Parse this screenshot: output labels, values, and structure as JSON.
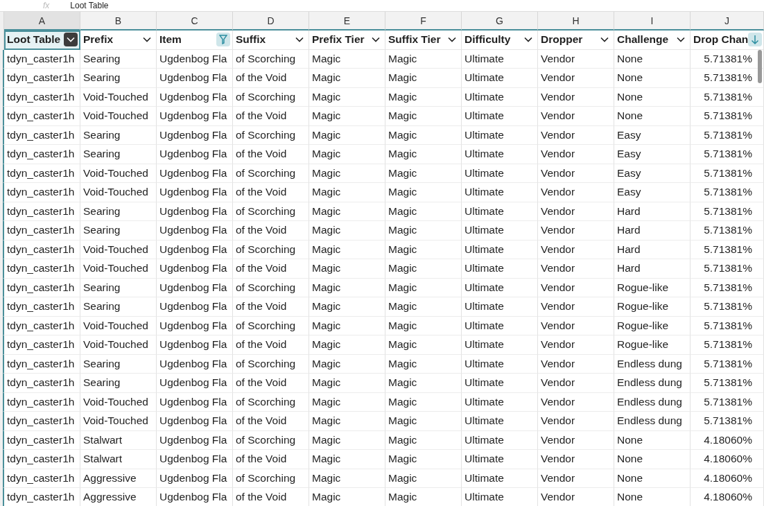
{
  "formula_bar": {
    "icon": "fx",
    "value": "Loot Table"
  },
  "column_letters": [
    "A",
    "B",
    "C",
    "D",
    "E",
    "F",
    "G",
    "H",
    "I",
    "J"
  ],
  "headers": [
    {
      "label": "Loot Table",
      "kind": "dropdown",
      "selected": true
    },
    {
      "label": "Prefix",
      "kind": "dropdown",
      "selected": false
    },
    {
      "label": "Item",
      "kind": "filter",
      "selected": false
    },
    {
      "label": "Suffix",
      "kind": "dropdown",
      "selected": false
    },
    {
      "label": "Prefix Tier",
      "kind": "dropdown",
      "selected": false
    },
    {
      "label": "Suffix Tier",
      "kind": "dropdown",
      "selected": false
    },
    {
      "label": "Difficulty",
      "kind": "dropdown",
      "selected": false
    },
    {
      "label": "Dropper",
      "kind": "dropdown",
      "selected": false
    },
    {
      "label": "Challenge",
      "kind": "dropdown",
      "selected": false
    },
    {
      "label": "Drop Chan",
      "kind": "sort",
      "selected": false
    }
  ],
  "rows": [
    [
      "tdyn_caster1h",
      "Searing",
      "Ugdenbog Fla",
      "of Scorching",
      "Magic",
      "Magic",
      "Ultimate",
      "Vendor",
      "None",
      "5.71381%"
    ],
    [
      "tdyn_caster1h",
      "Searing",
      "Ugdenbog Fla",
      "of the Void",
      "Magic",
      "Magic",
      "Ultimate",
      "Vendor",
      "None",
      "5.71381%"
    ],
    [
      "tdyn_caster1h",
      "Void-Touched",
      "Ugdenbog Fla",
      "of Scorching",
      "Magic",
      "Magic",
      "Ultimate",
      "Vendor",
      "None",
      "5.71381%"
    ],
    [
      "tdyn_caster1h",
      "Void-Touched",
      "Ugdenbog Fla",
      "of the Void",
      "Magic",
      "Magic",
      "Ultimate",
      "Vendor",
      "None",
      "5.71381%"
    ],
    [
      "tdyn_caster1h",
      "Searing",
      "Ugdenbog Fla",
      "of Scorching",
      "Magic",
      "Magic",
      "Ultimate",
      "Vendor",
      "Easy",
      "5.71381%"
    ],
    [
      "tdyn_caster1h",
      "Searing",
      "Ugdenbog Fla",
      "of the Void",
      "Magic",
      "Magic",
      "Ultimate",
      "Vendor",
      "Easy",
      "5.71381%"
    ],
    [
      "tdyn_caster1h",
      "Void-Touched",
      "Ugdenbog Fla",
      "of Scorching",
      "Magic",
      "Magic",
      "Ultimate",
      "Vendor",
      "Easy",
      "5.71381%"
    ],
    [
      "tdyn_caster1h",
      "Void-Touched",
      "Ugdenbog Fla",
      "of the Void",
      "Magic",
      "Magic",
      "Ultimate",
      "Vendor",
      "Easy",
      "5.71381%"
    ],
    [
      "tdyn_caster1h",
      "Searing",
      "Ugdenbog Fla",
      "of Scorching",
      "Magic",
      "Magic",
      "Ultimate",
      "Vendor",
      "Hard",
      "5.71381%"
    ],
    [
      "tdyn_caster1h",
      "Searing",
      "Ugdenbog Fla",
      "of the Void",
      "Magic",
      "Magic",
      "Ultimate",
      "Vendor",
      "Hard",
      "5.71381%"
    ],
    [
      "tdyn_caster1h",
      "Void-Touched",
      "Ugdenbog Fla",
      "of Scorching",
      "Magic",
      "Magic",
      "Ultimate",
      "Vendor",
      "Hard",
      "5.71381%"
    ],
    [
      "tdyn_caster1h",
      "Void-Touched",
      "Ugdenbog Fla",
      "of the Void",
      "Magic",
      "Magic",
      "Ultimate",
      "Vendor",
      "Hard",
      "5.71381%"
    ],
    [
      "tdyn_caster1h",
      "Searing",
      "Ugdenbog Fla",
      "of Scorching",
      "Magic",
      "Magic",
      "Ultimate",
      "Vendor",
      "Rogue-like",
      "5.71381%"
    ],
    [
      "tdyn_caster1h",
      "Searing",
      "Ugdenbog Fla",
      "of the Void",
      "Magic",
      "Magic",
      "Ultimate",
      "Vendor",
      "Rogue-like",
      "5.71381%"
    ],
    [
      "tdyn_caster1h",
      "Void-Touched",
      "Ugdenbog Fla",
      "of Scorching",
      "Magic",
      "Magic",
      "Ultimate",
      "Vendor",
      "Rogue-like",
      "5.71381%"
    ],
    [
      "tdyn_caster1h",
      "Void-Touched",
      "Ugdenbog Fla",
      "of the Void",
      "Magic",
      "Magic",
      "Ultimate",
      "Vendor",
      "Rogue-like",
      "5.71381%"
    ],
    [
      "tdyn_caster1h",
      "Searing",
      "Ugdenbog Fla",
      "of Scorching",
      "Magic",
      "Magic",
      "Ultimate",
      "Vendor",
      "Endless dung",
      "5.71381%"
    ],
    [
      "tdyn_caster1h",
      "Searing",
      "Ugdenbog Fla",
      "of the Void",
      "Magic",
      "Magic",
      "Ultimate",
      "Vendor",
      "Endless dung",
      "5.71381%"
    ],
    [
      "tdyn_caster1h",
      "Void-Touched",
      "Ugdenbog Fla",
      "of Scorching",
      "Magic",
      "Magic",
      "Ultimate",
      "Vendor",
      "Endless dung",
      "5.71381%"
    ],
    [
      "tdyn_caster1h",
      "Void-Touched",
      "Ugdenbog Fla",
      "of the Void",
      "Magic",
      "Magic",
      "Ultimate",
      "Vendor",
      "Endless dung",
      "5.71381%"
    ],
    [
      "tdyn_caster1h",
      "Stalwart",
      "Ugdenbog Fla",
      "of Scorching",
      "Magic",
      "Magic",
      "Ultimate",
      "Vendor",
      "None",
      "4.18060%"
    ],
    [
      "tdyn_caster1h",
      "Stalwart",
      "Ugdenbog Fla",
      "of the Void",
      "Magic",
      "Magic",
      "Ultimate",
      "Vendor",
      "None",
      "4.18060%"
    ],
    [
      "tdyn_caster1h",
      "Aggressive",
      "Ugdenbog Fla",
      "of Scorching",
      "Magic",
      "Magic",
      "Ultimate",
      "Vendor",
      "None",
      "4.18060%"
    ],
    [
      "tdyn_caster1h",
      "Aggressive",
      "Ugdenbog Fla",
      "of the Void",
      "Magic",
      "Magic",
      "Ultimate",
      "Vendor",
      "None",
      "4.18060%"
    ]
  ]
}
